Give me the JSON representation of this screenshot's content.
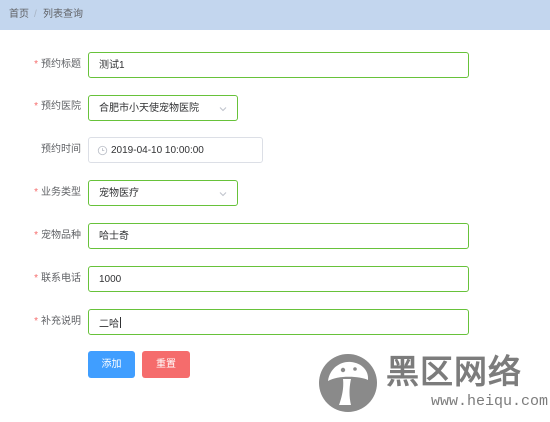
{
  "breadcrumb": {
    "home": "首页",
    "separator": "/",
    "current": "列表查询"
  },
  "form": {
    "fields": [
      {
        "label": "预约标题",
        "required": true,
        "value": "测试1"
      },
      {
        "label": "预约医院",
        "required": true,
        "value": "合肥市小天使宠物医院"
      },
      {
        "label": "预约时间",
        "required": false,
        "value": "2019-04-10 10:00:00"
      },
      {
        "label": "业务类型",
        "required": true,
        "value": "宠物医疗"
      },
      {
        "label": "宠物品种",
        "required": true,
        "value": "哈士奇"
      },
      {
        "label": "联系电话",
        "required": true,
        "value": "1000"
      },
      {
        "label": "补充说明",
        "required": true,
        "value": "二哈"
      }
    ],
    "required_mark": "*"
  },
  "buttons": {
    "add": "添加",
    "reset": "重置"
  },
  "watermark": {
    "title": "黑区网络",
    "url": "www.heiqu.com"
  },
  "colors": {
    "topbar": "#c3d6ee",
    "valid_border": "#67c23a",
    "required": "#f56c6c",
    "primary": "#409eff",
    "danger": "#f56c6c",
    "watermark": "#7c7c7c"
  },
  "icons": {
    "select_arrow": "chevron-down-icon",
    "time_prefix": "clock-icon",
    "watermark_logo": "mushroom-logo-icon"
  }
}
